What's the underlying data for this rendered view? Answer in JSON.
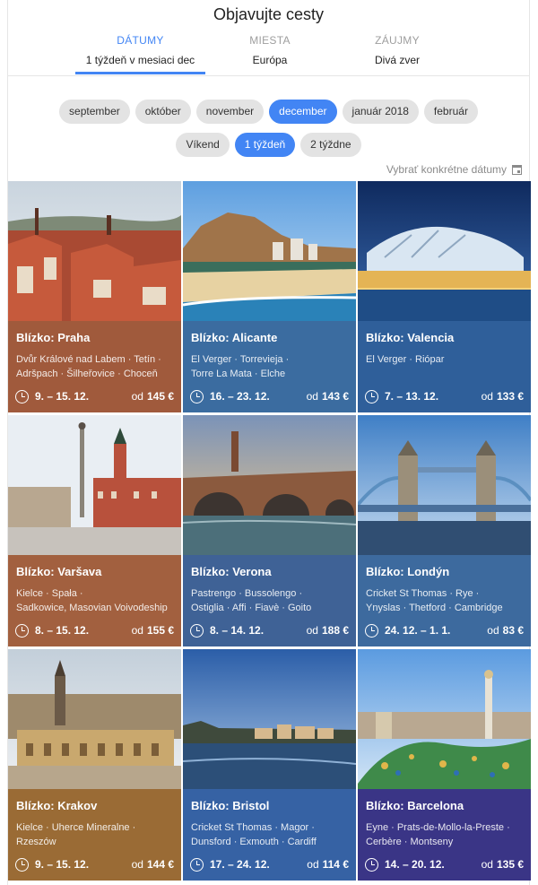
{
  "header": {
    "title": "Objavujte cesty"
  },
  "tabs": [
    {
      "label": "DÁTUMY",
      "value": "1 týždeň v mesiaci dec"
    },
    {
      "label": "MIESTA",
      "value": "Európa"
    },
    {
      "label": "ZÁUJMY",
      "value": "Divá zver"
    }
  ],
  "months": [
    "september",
    "október",
    "november",
    "december",
    "január 2018",
    "február"
  ],
  "selected_month": "december",
  "durations": [
    "Víkend",
    "1 týždeň",
    "2 týždne"
  ],
  "selected_duration": "1 týždeň",
  "specific_dates": "Vybrať konkrétne dátumy",
  "colors": {
    "accent": "#4285f4",
    "chip": "#e3e3e3"
  },
  "cards": [
    {
      "near": "Blízko: Praha",
      "line1": "Dvůr Králové nad Labem · Tetín ·",
      "line2": "Adršpach · Šilheřovice · Choceň",
      "dates": "9. – 15. 12.",
      "od": "od",
      "price": "145 €",
      "color": "#a05a3c"
    },
    {
      "near": "Blízko: Alicante",
      "line1": "El Verger · Torrevieja ·",
      "line2": "Torre La Mata · Elche",
      "dates": "16. – 23. 12.",
      "od": "od",
      "price": "143 €",
      "color": "#3b6ca0"
    },
    {
      "near": "Blízko: Valencia",
      "line1": "El Verger · Riópar",
      "line2": "",
      "dates": "7. – 13. 12.",
      "od": "od",
      "price": "133 €",
      "color": "#2f5f9a"
    },
    {
      "near": "Blízko: Varšava",
      "line1": "Kielce · Spała ·",
      "line2": "Sadkowice, Masovian Voivodeship",
      "dates": "8. – 15. 12.",
      "od": "od",
      "price": "155 €",
      "color": "#a2603f"
    },
    {
      "near": "Blízko: Verona",
      "line1": "Pastrengo · Bussolengo ·",
      "line2": "Ostiglia · Affi · Fiavè · Goito",
      "dates": "8. – 14. 12.",
      "od": "od",
      "price": "188 €",
      "color": "#3f6296"
    },
    {
      "near": "Blízko: Londýn",
      "line1": "Cricket St Thomas · Rye ·",
      "line2": "Ynyslas · Thetford · Cambridge",
      "dates": "24. 12. – 1. 1.",
      "od": "od",
      "price": "83 €",
      "color": "#3d6a9e"
    },
    {
      "near": "Blízko: Krakov",
      "line1": "Kielce · Uherce Mineralne ·",
      "line2": "Rzeszów",
      "dates": "9. – 15. 12.",
      "od": "od",
      "price": "144 €",
      "color": "#9a6b35"
    },
    {
      "near": "Blízko: Bristol",
      "line1": "Cricket St Thomas · Magor ·",
      "line2": "Dunsford · Exmouth · Cardiff",
      "dates": "17. – 24. 12.",
      "od": "od",
      "price": "114 €",
      "color": "#3662a4"
    },
    {
      "near": "Blízko: Barcelona",
      "line1": "Eyne · Prats-de-Mollo-la-Preste ·",
      "line2": "Cerbère · Montseny",
      "dates": "14. – 20. 12.",
      "od": "od",
      "price": "135 €",
      "color": "#3a3586"
    }
  ]
}
